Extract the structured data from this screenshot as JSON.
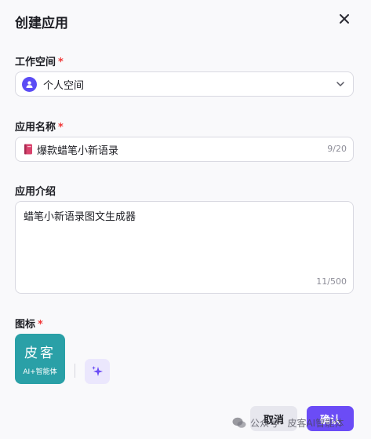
{
  "dialog": {
    "title": "创建应用"
  },
  "workspace": {
    "label": "工作空间",
    "required_mark": "*",
    "value": "个人空间"
  },
  "app_name": {
    "label": "应用名称",
    "required_mark": "*",
    "value": "爆款蜡笔小新语录",
    "counter": "9/20"
  },
  "app_intro": {
    "label": "应用介绍",
    "value": "蜡笔小新语录图文生成器",
    "counter": "11/500"
  },
  "icon_section": {
    "label": "图标",
    "required_mark": "*",
    "tile_top": "皮客",
    "tile_bottom": "AI+智能体"
  },
  "actions": {
    "cancel": "取消",
    "confirm": "确认"
  },
  "watermark": {
    "text": "公众号 · 皮客AI智能体"
  },
  "icons": {
    "close": "close-icon",
    "chevron": "chevron-down-icon",
    "avatar": "user-avatar-icon",
    "book": "book-icon",
    "ai": "sparkle-icon"
  },
  "colors": {
    "accent": "#6b4cf6",
    "required": "#f03838",
    "tile": "#2aa0a7"
  }
}
